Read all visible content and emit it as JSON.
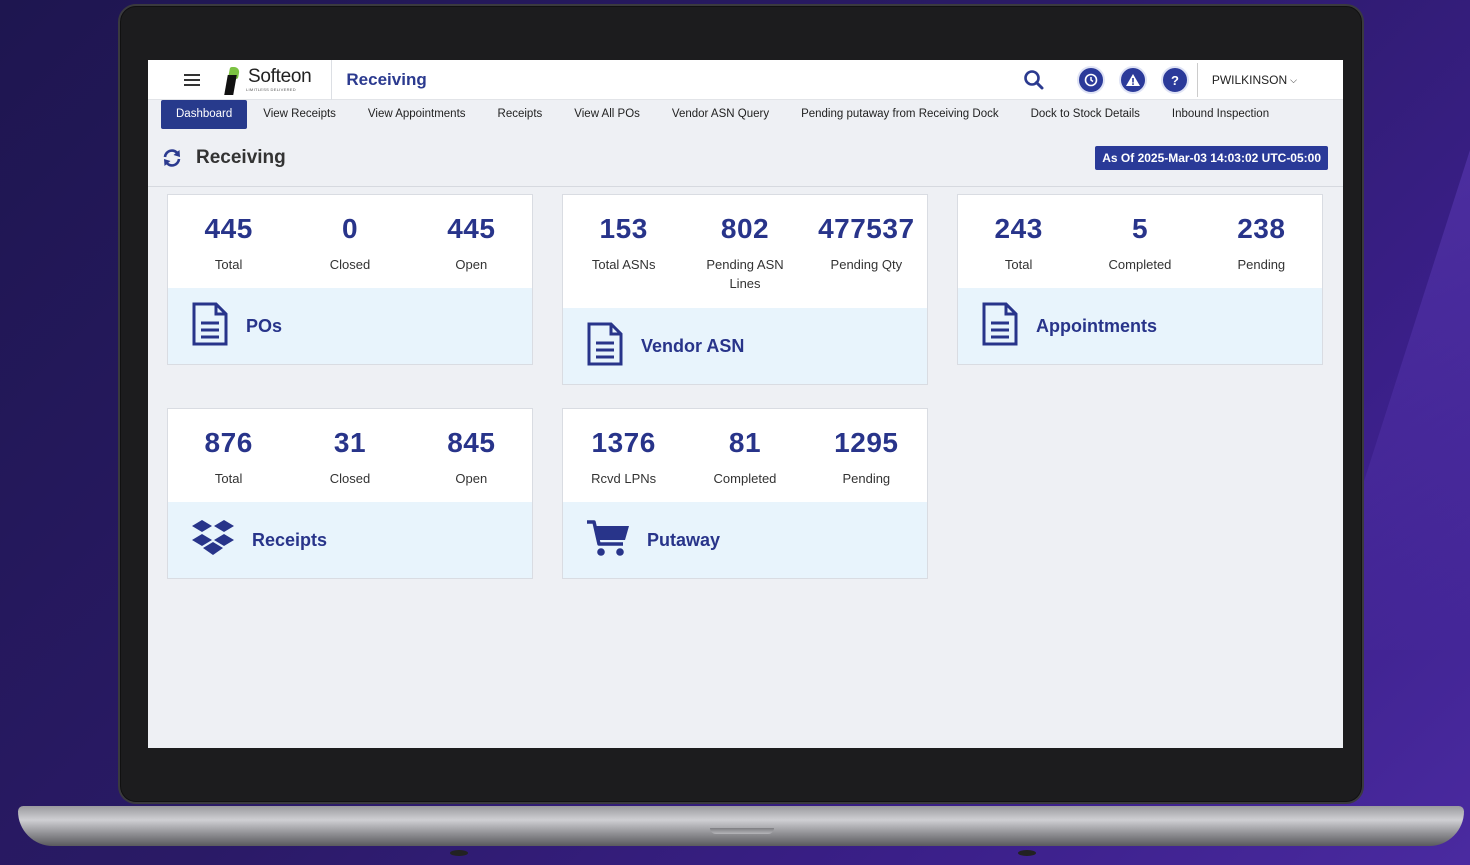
{
  "app": {
    "logo_text": "Softeon",
    "logo_tagline": "LIMITLESS DELIVERED",
    "module_title": "Receiving",
    "user": "PWILKINSON"
  },
  "tabs": [
    {
      "label": "Dashboard",
      "active": true
    },
    {
      "label": "View Receipts"
    },
    {
      "label": "View Appointments"
    },
    {
      "label": "Receipts"
    },
    {
      "label": "View All POs"
    },
    {
      "label": "Vendor ASN Query"
    },
    {
      "label": "Pending putaway from Receiving Dock"
    },
    {
      "label": "Dock to Stock Details"
    },
    {
      "label": "Inbound Inspection"
    }
  ],
  "page": {
    "title": "Receiving",
    "as_of": "As Of 2025-Mar-03 14:03:02 UTC-05:00"
  },
  "cards": {
    "pos": {
      "title": "POs",
      "stats": [
        {
          "value": "445",
          "label": "Total"
        },
        {
          "value": "0",
          "label": "Closed"
        },
        {
          "value": "445",
          "label": "Open"
        }
      ]
    },
    "vendor_asn": {
      "title": "Vendor ASN",
      "stats": [
        {
          "value": "153",
          "label": "Total ASNs"
        },
        {
          "value": "802",
          "label": "Pending ASN Lines"
        },
        {
          "value": "477537",
          "label": "Pending Qty"
        }
      ]
    },
    "appointments": {
      "title": "Appointments",
      "stats": [
        {
          "value": "243",
          "label": "Total"
        },
        {
          "value": "5",
          "label": "Completed"
        },
        {
          "value": "238",
          "label": "Pending"
        }
      ]
    },
    "receipts": {
      "title": "Receipts",
      "stats": [
        {
          "value": "876",
          "label": "Total"
        },
        {
          "value": "31",
          "label": "Closed"
        },
        {
          "value": "845",
          "label": "Open"
        }
      ]
    },
    "putaway": {
      "title": "Putaway",
      "stats": [
        {
          "value": "1376",
          "label": "Rcvd LPNs"
        },
        {
          "value": "81",
          "label": "Completed"
        },
        {
          "value": "1295",
          "label": "Pending"
        }
      ]
    }
  },
  "colors": {
    "accent": "#28348a",
    "tab_active": "#273a8c",
    "card_footer": "#e8f4fc"
  }
}
